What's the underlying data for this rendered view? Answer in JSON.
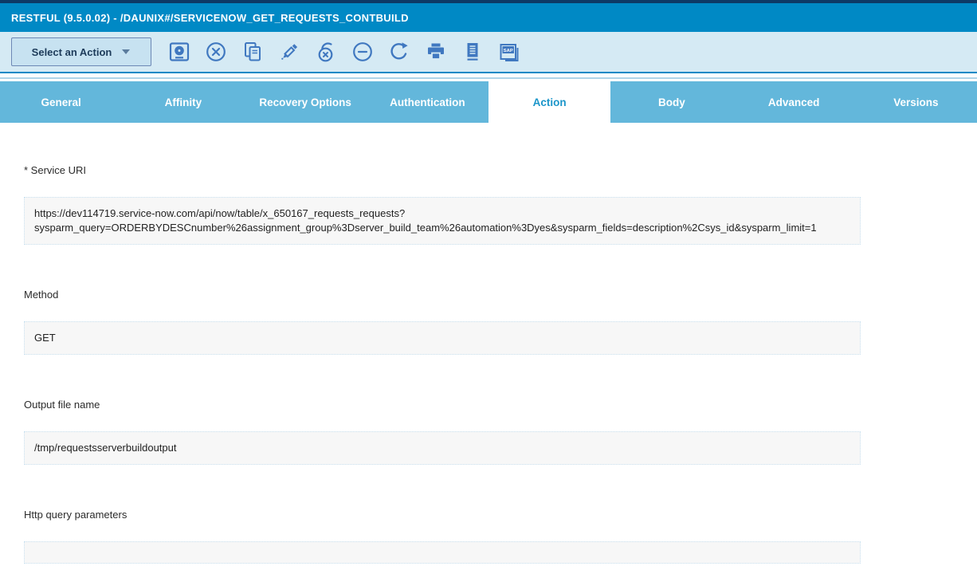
{
  "window": {
    "title": "RESTFUL (9.5.0.02) - /DAUNIX#/SERVICENOW_GET_REQUESTS_CONTBUILD"
  },
  "toolbar": {
    "action_button_label": "Select an Action",
    "icons": [
      "disk-icon",
      "close-circle-icon",
      "copy-icon",
      "edit-pencil-icon",
      "free-circle-x-icon",
      "minus-circle-icon",
      "redo-arrow-icon",
      "printer-icon",
      "document-icon",
      "sap-icon"
    ],
    "sap_icon_label": "SAP"
  },
  "tabs": [
    {
      "label": "General",
      "active": false
    },
    {
      "label": "Affinity",
      "active": false
    },
    {
      "label": "Recovery Options",
      "active": false
    },
    {
      "label": "Authentication",
      "active": false
    },
    {
      "label": "Action",
      "active": true
    },
    {
      "label": "Body",
      "active": false
    },
    {
      "label": "Advanced",
      "active": false
    },
    {
      "label": "Versions",
      "active": false
    }
  ],
  "form": {
    "fields": [
      {
        "label": "* Service URI",
        "value": "https://dev114719.service-now.com/api/now/table/x_650167_requests_requests?\nsysparm_query=ORDERBYDESCnumber%26assignment_group%3Dserver_build_team%26automation%3Dyes&sysparm_fields=description%2Csys_id&sysparm_limit=1"
      },
      {
        "label": "Method",
        "value": "GET"
      },
      {
        "label": "Output file name",
        "value": "/tmp/requestsserverbuildoutput"
      },
      {
        "label": "Http query parameters",
        "value": ""
      }
    ]
  },
  "colors": {
    "top_strip": "#0d3a66",
    "title_bar": "#0089c5",
    "toolbar_bg": "#d5eaf4",
    "toolbar_separator": "#0989c5",
    "tab_bar": "#63b7db",
    "active_tab_text": "#1b95c9",
    "icon_blue": "#4078c0",
    "field_bg": "#f7f7f7",
    "field_border": "#c9e1f0"
  }
}
